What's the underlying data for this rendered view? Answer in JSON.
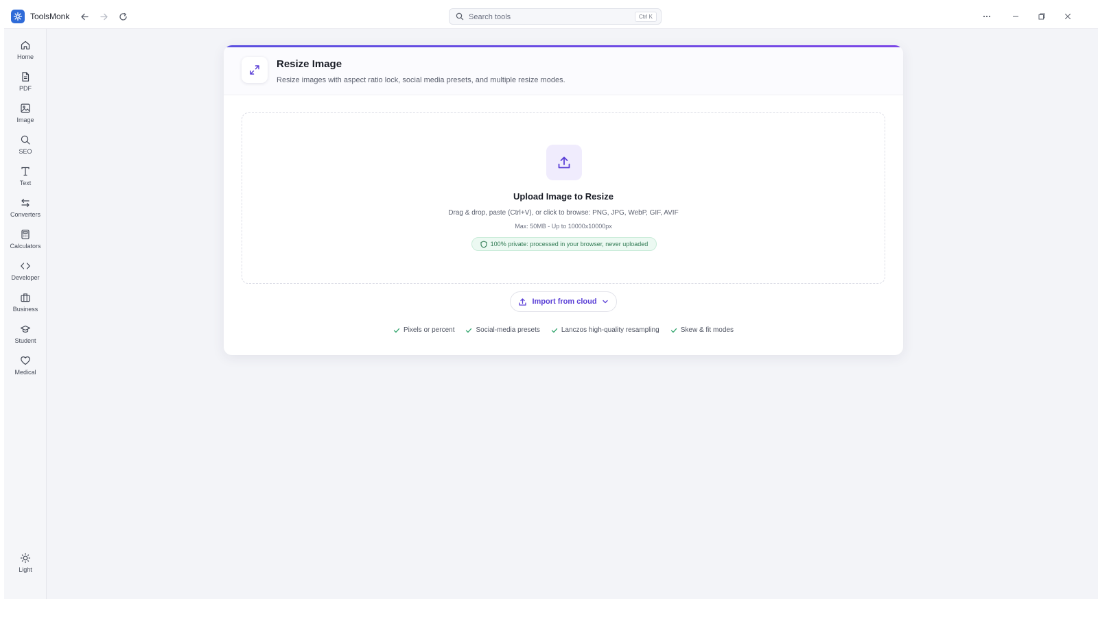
{
  "app": {
    "title": "ToolsMonk"
  },
  "search": {
    "placeholder": "Search tools",
    "shortcut": "Ctrl K"
  },
  "sidebar": {
    "items": [
      {
        "label": "Home",
        "icon": "home-icon"
      },
      {
        "label": "PDF",
        "icon": "file-icon"
      },
      {
        "label": "Image",
        "icon": "image-icon"
      },
      {
        "label": "SEO",
        "icon": "search-icon"
      },
      {
        "label": "Text",
        "icon": "type-icon"
      },
      {
        "label": "Converters",
        "icon": "swap-icon"
      },
      {
        "label": "Calculators",
        "icon": "calculator-icon"
      },
      {
        "label": "Developer",
        "icon": "code-icon"
      },
      {
        "label": "Business",
        "icon": "briefcase-icon"
      },
      {
        "label": "Student",
        "icon": "graduation-cap-icon"
      },
      {
        "label": "Medical",
        "icon": "heart-icon"
      }
    ],
    "theme_label": "Light"
  },
  "tool": {
    "title": "Resize Image",
    "description": "Resize images with aspect ratio lock, social media presets, and multiple resize modes."
  },
  "upload": {
    "title": "Upload Image to Resize",
    "description": "Drag & drop, paste (Ctrl+V), or click to browse: PNG, JPG, WebP, GIF, AVIF",
    "limits": "Max: 50MB - Up to 10000x10000px",
    "privacy": "100% private: processed in your browser, never uploaded"
  },
  "import": {
    "label": "Import from cloud"
  },
  "features": [
    "Pixels or percent",
    "Social-media presets",
    "Lanczos high-quality resampling",
    "Skew & fit modes"
  ],
  "colors": {
    "accent": "#5a3fd6",
    "brand": "#2f6bd8",
    "success": "#2f7a52"
  }
}
